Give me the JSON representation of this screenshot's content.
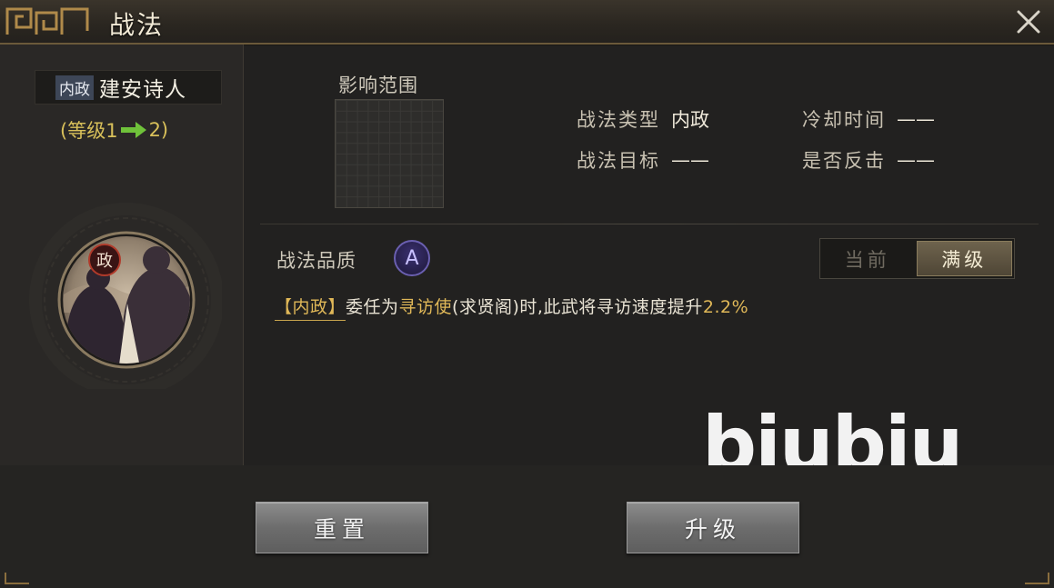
{
  "window": {
    "title": "战法"
  },
  "skill": {
    "type_tag": "内政",
    "name": "建安诗人",
    "level_prefix": "(等级1",
    "level_suffix": "2)",
    "portrait_badge": "政"
  },
  "range": {
    "label": "影响范围"
  },
  "info": {
    "type_key": "战法类型",
    "type_val": "内政",
    "cooldown_key": "冷却时间",
    "cooldown_val": "——",
    "target_key": "战法目标",
    "target_val": "——",
    "counter_key": "是否反击",
    "counter_val": "——"
  },
  "quality": {
    "label": "战法品质",
    "grade": "A"
  },
  "toggle": {
    "current": "当前",
    "max": "满级",
    "selected": "max"
  },
  "description": {
    "tag": "【内政】",
    "part1": "委任为",
    "highlight1": "寻访使",
    "part2": "(求贤阁)时,此武将寻访速度提升",
    "highlight2": "2.2%"
  },
  "watermark": "biubiu",
  "buttons": {
    "reset": "重置",
    "upgrade": "升级"
  },
  "colors": {
    "accent_gold": "#e0b858",
    "level_green": "#6fc23a",
    "quality_purple": "#6a5fb0"
  }
}
